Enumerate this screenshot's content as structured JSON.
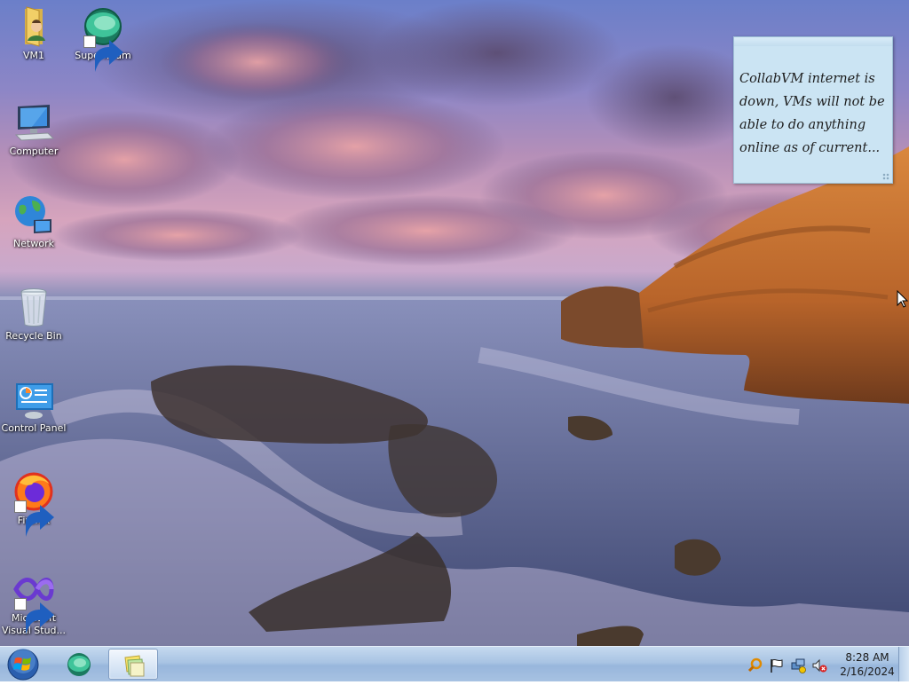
{
  "desktop": {
    "icons": [
      {
        "label": "VM1"
      },
      {
        "label": "Supermium"
      },
      {
        "label": "Computer"
      },
      {
        "label": "Network"
      },
      {
        "label": "Recycle Bin"
      },
      {
        "label": "Control Panel"
      },
      {
        "label": "Firefox"
      },
      {
        "label": "Microsoft Visual Stud..."
      }
    ]
  },
  "sticky_note": {
    "text": "CollabVM internet is down, VMs will not be able to do anything online as of current..."
  },
  "taskbar": {
    "clock": {
      "time": "8:28 AM",
      "date": "2/16/2024"
    },
    "pinned": [
      "supermium-icon",
      "sticky-notes-icon"
    ],
    "tray": [
      "search-icon",
      "action-center-flag-icon",
      "network-icon",
      "volume-muted-icon"
    ]
  },
  "colors": {
    "taskbar": "#a9c4e3",
    "sticky_note": "#cbe4f3",
    "icon_text": "#ffffff"
  }
}
